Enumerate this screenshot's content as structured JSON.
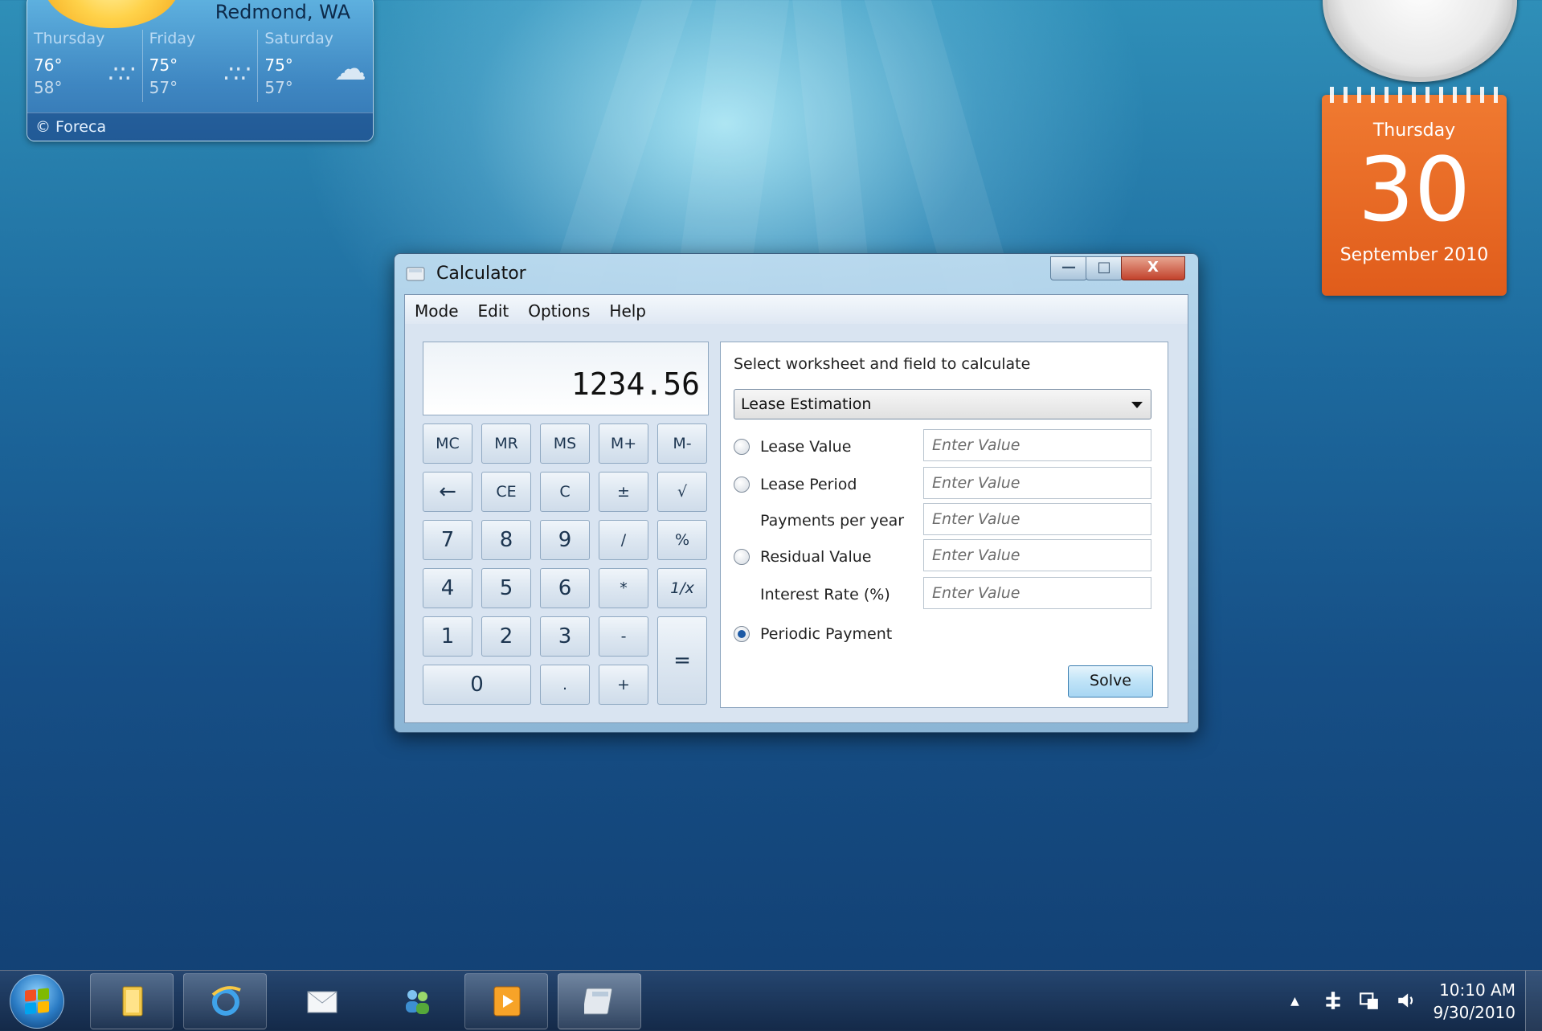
{
  "weather": {
    "city": "Redmond, WA",
    "days": [
      {
        "name": "Thursday",
        "high": "76°",
        "low": "58°"
      },
      {
        "name": "Friday",
        "high": "75°",
        "low": "57°"
      },
      {
        "name": "Saturday",
        "high": "75°",
        "low": "57°"
      }
    ],
    "source": "© Foreca"
  },
  "calendar": {
    "weekday": "Thursday",
    "day": "30",
    "month_year": "September 2010",
    "color": "#e8661f"
  },
  "window": {
    "title": "Calculator",
    "controls": {
      "minimize": "—",
      "maximize": "□",
      "close": "X"
    },
    "menu": [
      "Mode",
      "Edit",
      "Options",
      "Help"
    ],
    "display": "1234.56",
    "memory_buttons": [
      "MC",
      "MR",
      "MS",
      "M+",
      "M-"
    ],
    "row2": [
      "←",
      "CE",
      "C",
      "±",
      "√"
    ],
    "row3": [
      "7",
      "8",
      "9",
      "/",
      "%"
    ],
    "row4": [
      "4",
      "5",
      "6",
      "*",
      "1/x"
    ],
    "row5": [
      "1",
      "2",
      "3",
      "-"
    ],
    "row6": [
      "0",
      ".",
      "+"
    ],
    "equals": "="
  },
  "worksheet": {
    "header": "Select worksheet and field to calculate",
    "selected": "Lease Estimation",
    "fields": [
      {
        "label": "Lease Value",
        "radio": true,
        "checked": false,
        "placeholder": "Enter Value"
      },
      {
        "label": "Lease Period",
        "radio": true,
        "checked": false,
        "placeholder": "Enter Value"
      },
      {
        "label": "Payments per year",
        "radio": false,
        "checked": false,
        "placeholder": "Enter Value"
      },
      {
        "label": "Residual Value",
        "radio": true,
        "checked": false,
        "placeholder": "Enter Value"
      },
      {
        "label": "Interest Rate (%)",
        "radio": false,
        "checked": false,
        "placeholder": "Enter Value"
      },
      {
        "label": "Periodic Payment",
        "radio": true,
        "checked": true
      }
    ],
    "solve_label": "Solve"
  },
  "taskbar": {
    "time": "10:10 AM",
    "date": "9/30/2010",
    "tray_arrow": "▲",
    "tray_icons": [
      "network-icon",
      "action-center-icon",
      "volume-icon"
    ]
  }
}
